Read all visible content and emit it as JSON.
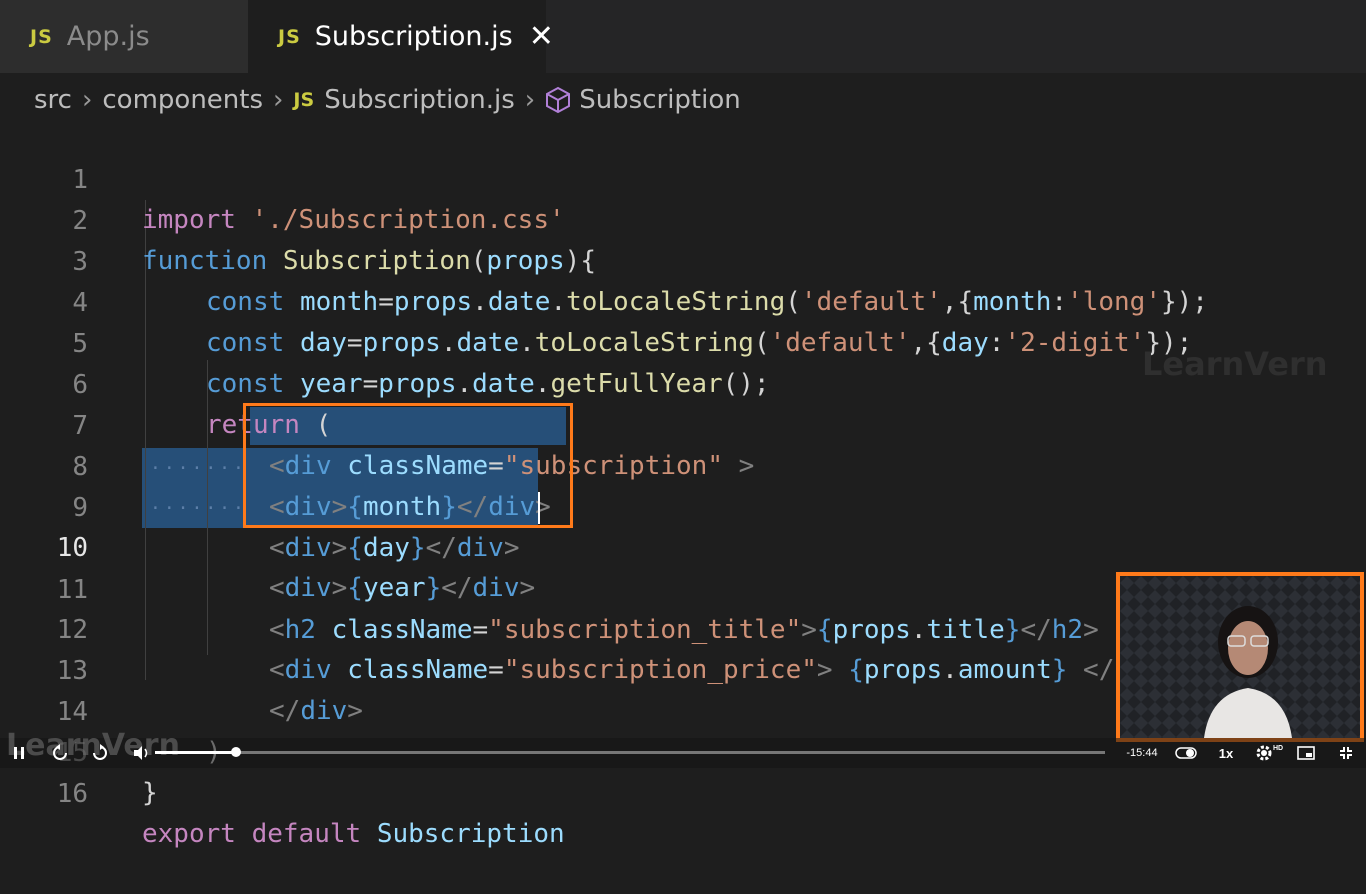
{
  "tabs": [
    {
      "badge": "JS",
      "name": "App.js",
      "active": false
    },
    {
      "badge": "JS",
      "name": "Subscription.js",
      "active": true,
      "close": "✕"
    }
  ],
  "breadcrumb": {
    "folder1": "src",
    "folder2": "components",
    "file_badge": "JS",
    "file": "Subscription.js",
    "symbol": "Subscription",
    "separator": "›"
  },
  "code": {
    "current_line": 10,
    "lines": [
      {
        "n": "1"
      },
      {
        "n": "2"
      },
      {
        "n": "3"
      },
      {
        "n": "4"
      },
      {
        "n": "5"
      },
      {
        "n": "6"
      },
      {
        "n": "7"
      },
      {
        "n": "8"
      },
      {
        "n": "9"
      },
      {
        "n": "10"
      },
      {
        "n": "11"
      },
      {
        "n": "12"
      },
      {
        "n": "13"
      },
      {
        "n": "14"
      },
      {
        "n": "15"
      },
      {
        "n": "16"
      }
    ],
    "l1": {
      "kw": "import",
      "str": "'./Subscription.css'"
    },
    "l2": {
      "kw": "function",
      "fn": "Subscription",
      "p1": "(",
      "arg": "props",
      "p2": "){"
    },
    "l3": {
      "kw": "const",
      "v": "month",
      "eq": "=",
      "obj": "props",
      "d1": ".",
      "prop": "date",
      "d2": ".",
      "fn": "toLocaleString",
      "o": "(",
      "s1": "'default'",
      "c": ",{",
      "k": "month",
      "col": ":",
      "s2": "'long'",
      "end": "});"
    },
    "l4": {
      "kw": "const",
      "v": "day",
      "eq": "=",
      "obj": "props",
      "d1": ".",
      "prop": "date",
      "d2": ".",
      "fn": "toLocaleString",
      "o": "(",
      "s1": "'default'",
      "c": ",{",
      "k": "day",
      "col": ":",
      "s2": "'2-digit'",
      "end": "});"
    },
    "l5": {
      "kw": "const",
      "v": "year",
      "eq": "=",
      "obj": "props",
      "d1": ".",
      "prop": "date",
      "d2": ".",
      "fn": "getFullYear",
      "end": "();"
    },
    "l6": {
      "kw": "return",
      "p": "("
    },
    "l7": {
      "lt": "<",
      "tag": "div",
      "attr": "className",
      "eq": "=",
      "str": "\"subscription\"",
      "gt": " >"
    },
    "l8": {
      "lt": "<",
      "tag": "div",
      "gt": ">",
      "ob": "{",
      "v": "month",
      "cb": "}",
      "clt": "</",
      "ctag": "div",
      "cgt": ">"
    },
    "l9": {
      "lt": "<",
      "tag": "div",
      "gt": ">",
      "ob": "{",
      "v": "day",
      "cb": "}",
      "clt": "</",
      "ctag": "div",
      "cgt": ">"
    },
    "l10": {
      "lt": "<",
      "tag": "div",
      "gt": ">",
      "ob": "{",
      "v": "year",
      "cb": "}",
      "clt": "</",
      "ctag": "div",
      "cgt": ">"
    },
    "l11": {
      "lt": "<",
      "tag": "h2",
      "attr": "className",
      "eq": "=",
      "str": "\"subscription_title\"",
      "gt": ">",
      "ob": "{",
      "obj": "props",
      "d": ".",
      "prop": "title",
      "cb": "}",
      "clt": "</",
      "ctag": "h2",
      "cgt": ">"
    },
    "l12": {
      "lt": "<",
      "tag": "div",
      "attr": "className",
      "eq": "=",
      "str": "\"subscription_price\"",
      "gt": ">",
      "ob": "{",
      "obj": "props",
      "d": ".",
      "prop": "amount",
      "cb": "}",
      "clt": "</"
    },
    "l13": {
      "clt": "</",
      "ctag": "div",
      "cgt": ">"
    },
    "l14": {
      "p": ")"
    },
    "l15": {
      "p": "}"
    },
    "l16": {
      "kw": "export",
      "kw2": "default",
      "name": "Subscription"
    }
  },
  "watermark": "LearnVern",
  "watermark_bottom": "LearnVern",
  "video": {
    "time_remaining": "-15:44",
    "playback_rate": "1x",
    "quality_badge": "HD",
    "progress": 0.085
  },
  "colors": {
    "accent": "#ff7a1a",
    "selection": "#264f78"
  }
}
